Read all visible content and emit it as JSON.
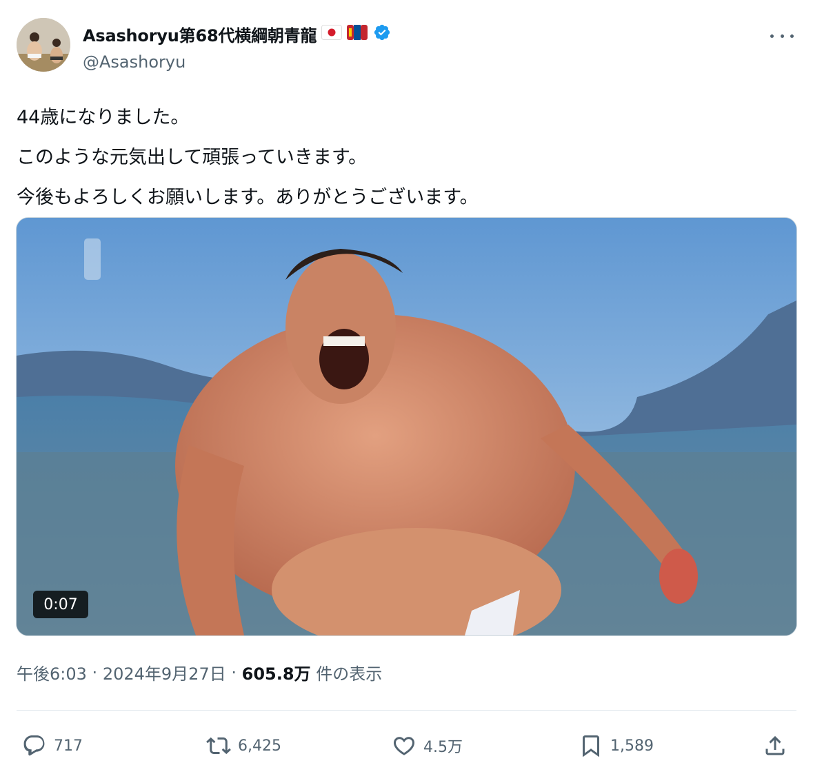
{
  "author": {
    "display_name": "Asashoryu第68代横綱朝青龍",
    "handle": "@Asashoryu",
    "avatar": "avatar-photo",
    "flags": [
      "japan-flag-icon",
      "mongolia-flag-icon"
    ],
    "verified_icon": "verified-badge-icon"
  },
  "more_icon": "more-options-icon",
  "tweet": {
    "lines": [
      "44歳になりました。",
      "このような元気出して頑張っていきます。",
      "今後もよろしくお願いします。ありがとうございます。"
    ]
  },
  "media": {
    "type": "video",
    "duration": "0:07"
  },
  "meta": {
    "time": "午後6:03",
    "separator": "·",
    "date": "2024年9月27日",
    "views_count": "605.8万",
    "views_label": "件の表示"
  },
  "actions": {
    "reply": {
      "icon": "reply-icon",
      "count": "717"
    },
    "retweet": {
      "icon": "retweet-icon",
      "count": "6,425"
    },
    "like": {
      "icon": "heart-icon",
      "count": "4.5万"
    },
    "bookmark": {
      "icon": "bookmark-icon",
      "count": "1,589"
    },
    "share": {
      "icon": "share-icon"
    }
  },
  "colors": {
    "text": "#0f1419",
    "secondary": "#536471",
    "verified": "#1d9bf0",
    "border": "#cfd9de"
  }
}
